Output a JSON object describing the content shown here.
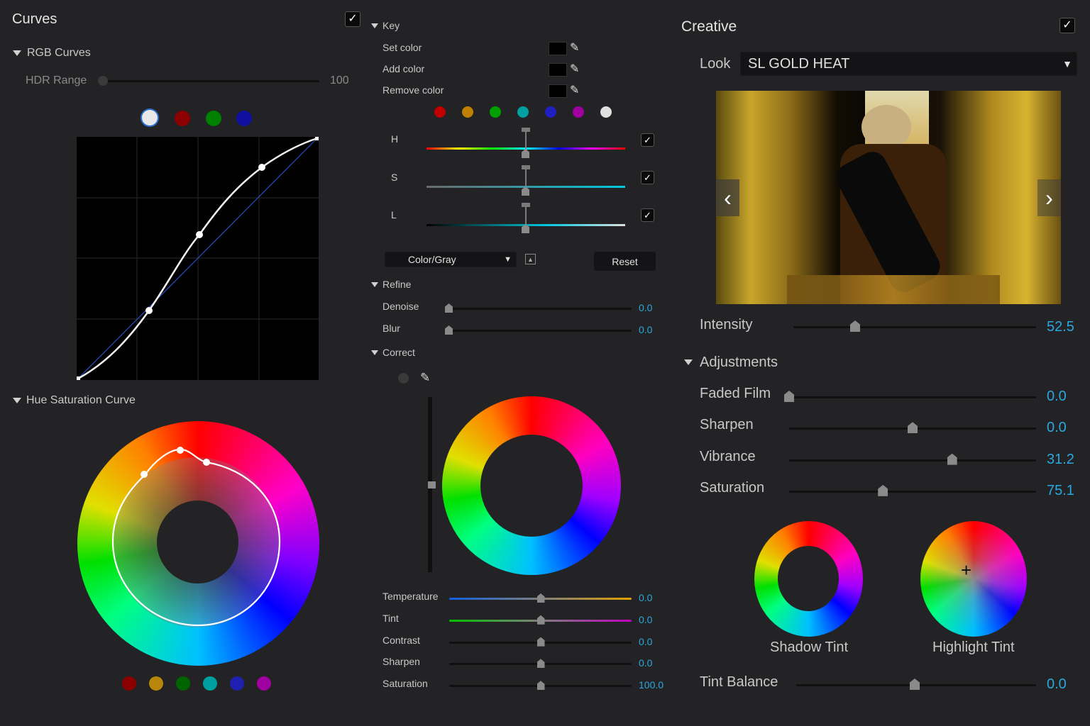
{
  "curves": {
    "title": "Curves",
    "rgb_curves": "RGB Curves",
    "hdr_label": "HDR Range",
    "hdr_value": "100",
    "hdr_level": 0.0,
    "channels": [
      "white",
      "red",
      "green",
      "blue"
    ],
    "hue_sat_curve": "Hue Saturation Curve",
    "hue_dots": [
      "#8b0000",
      "#b8860b",
      "#006400",
      "#00a0a0",
      "#2020b0",
      "#a000a0"
    ]
  },
  "key": {
    "title": "Key",
    "set_color": "Set color",
    "add_color": "Add color",
    "remove_color": "Remove color",
    "color_dots": [
      "#c00000",
      "#c08000",
      "#00a000",
      "#00a0a0",
      "#2020c0",
      "#a000a0",
      "#e0e0e0"
    ],
    "h_label": "H",
    "s_label": "S",
    "l_label": "L",
    "mode": "Color/Gray",
    "reset": "Reset"
  },
  "refine": {
    "title": "Refine",
    "denoise_label": "Denoise",
    "denoise_value": "0.0",
    "blur_label": "Blur",
    "blur_value": "0.0"
  },
  "correct": {
    "title": "Correct",
    "sliders": [
      {
        "label": "Temperature",
        "value": "0.0",
        "level": 0.5
      },
      {
        "label": "Tint",
        "value": "0.0",
        "level": 0.5
      },
      {
        "label": "Contrast",
        "value": "0.0",
        "level": 0.5
      },
      {
        "label": "Sharpen",
        "value": "0.0",
        "level": 0.5
      },
      {
        "label": "Saturation",
        "value": "100.0",
        "level": 0.5
      }
    ]
  },
  "creative": {
    "title": "Creative",
    "look_label": "Look",
    "look_value": "SL GOLD HEAT",
    "intensity_label": "Intensity",
    "intensity_value": "52.5",
    "adjustments_title": "Adjustments",
    "adjustments": [
      {
        "label": "Faded Film",
        "value": "0.0",
        "level": 0.0
      },
      {
        "label": "Sharpen",
        "value": "0.0",
        "level": 0.5
      },
      {
        "label": "Vibrance",
        "value": "31.2",
        "level": 0.66
      },
      {
        "label": "Saturation",
        "value": "75.1",
        "level": 0.38
      }
    ],
    "shadow_tint": "Shadow Tint",
    "highlight_tint": "Highlight Tint",
    "tint_balance_label": "Tint Balance",
    "tint_balance_value": "0.0"
  },
  "colors": {
    "accent": "#29a8e0",
    "background": "#232325"
  }
}
